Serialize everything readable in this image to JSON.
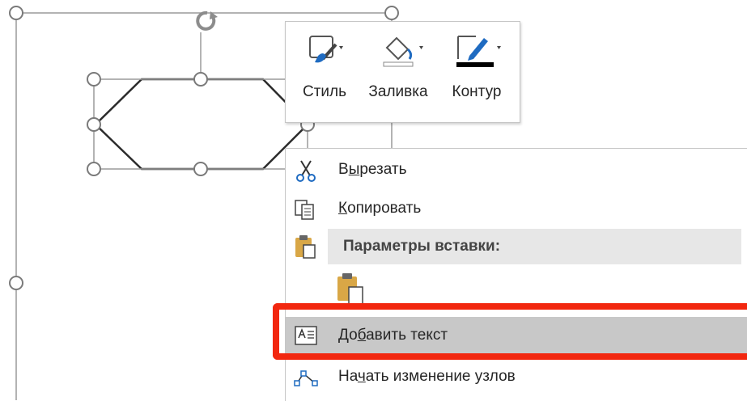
{
  "mini_toolbar": {
    "style_label": "Стиль",
    "fill_label": "Заливка",
    "outline_label": "Контур"
  },
  "context_menu": {
    "cut": {
      "pre": "В",
      "u": "ы",
      "post": "резать"
    },
    "copy": {
      "pre": "",
      "u": "К",
      "post": "опировать"
    },
    "paste_options_header": "Параметры вставки:",
    "add_text": {
      "pre": "До",
      "u": "б",
      "post": "авить текст"
    },
    "edit_points": {
      "pre": "На",
      "u": "ч",
      "post": "ать изменение узлов"
    }
  },
  "colors": {
    "highlight_frame": "#f2270f",
    "menu_hover": "#c8c8c8",
    "section_bg": "#e7e7e7",
    "outline_swatch": "#000000",
    "accent_blue": "#1f6bc1"
  },
  "icons": [
    "style-brush-icon",
    "fill-bucket-icon",
    "outline-pen-icon",
    "scissors-icon",
    "copy-icon",
    "paste-icon",
    "paste-keep-format-icon",
    "add-text-icon",
    "edit-points-icon",
    "rotate-handle-icon"
  ]
}
